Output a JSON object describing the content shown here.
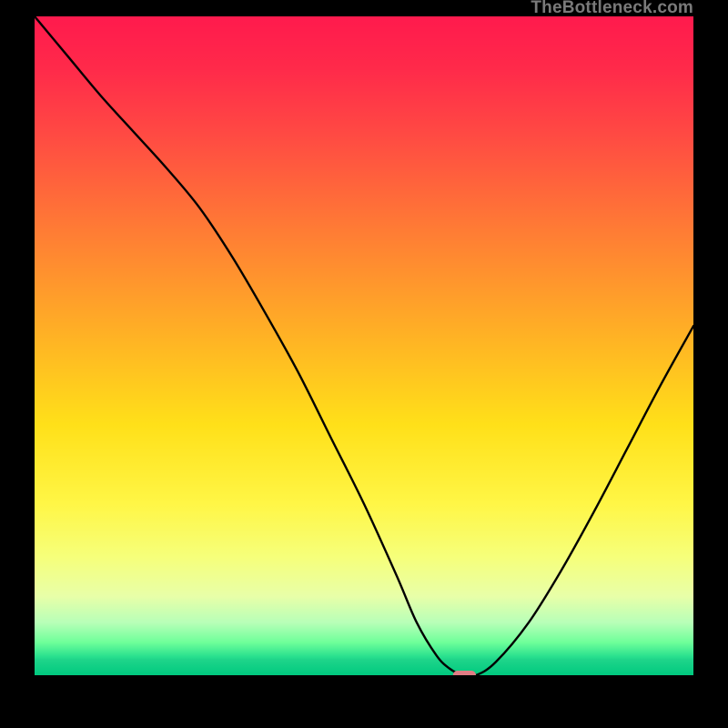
{
  "attribution": "TheBottleneck.com",
  "chart_data": {
    "type": "line",
    "title": "",
    "xlabel": "",
    "ylabel": "",
    "xlim": [
      0,
      100
    ],
    "ylim": [
      0,
      100
    ],
    "x": [
      0,
      5,
      10,
      15,
      20,
      25,
      30,
      35,
      40,
      45,
      50,
      55,
      58,
      61,
      63,
      65,
      67,
      70,
      75,
      80,
      85,
      90,
      95,
      100
    ],
    "values": [
      100,
      94,
      88,
      82.5,
      77,
      71,
      63.5,
      55,
      46,
      36,
      26,
      15,
      8,
      3,
      1,
      0,
      0,
      2,
      8,
      16,
      25,
      34.5,
      44,
      53
    ],
    "marker_x_range": [
      63.5,
      67
    ],
    "marker_y": 0
  }
}
